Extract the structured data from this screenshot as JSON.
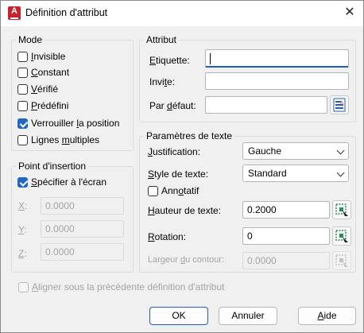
{
  "window": {
    "title": "Définition d'attribut",
    "close_glyph": "✕",
    "app_icon_letter": "A"
  },
  "mode": {
    "title": "Mode",
    "items": [
      {
        "pre": "",
        "ul": "I",
        "post": "nvisible",
        "checked": false
      },
      {
        "pre": "",
        "ul": "C",
        "post": "onstant",
        "checked": false
      },
      {
        "pre": "",
        "ul": "V",
        "post": "érifié",
        "checked": false
      },
      {
        "pre": "",
        "ul": "P",
        "post": "rédéfini",
        "checked": false
      },
      {
        "pre": "Verrouiller ",
        "ul": "l",
        "post": "a position",
        "checked": true
      },
      {
        "pre": "Lignes ",
        "ul": "m",
        "post": "ultiples",
        "checked": false
      }
    ]
  },
  "insertion": {
    "title": "Point d'insertion",
    "specify": {
      "pre": "",
      "ul": "S",
      "post": "pécifier à l'écran",
      "checked": true
    },
    "x": {
      "label_ul": "X",
      "label_post": ":",
      "value": "0.0000"
    },
    "y": {
      "label_ul": "Y",
      "label_post": ":",
      "value": "0.0000"
    },
    "z": {
      "label_ul": "Z",
      "label_post": ":",
      "value": "0.0000"
    }
  },
  "attribute": {
    "title": "Attribut",
    "tag": {
      "pre": "",
      "ul": "E",
      "post": "tiquette:",
      "value": ""
    },
    "prompt": {
      "pre": "Invi",
      "ul": "t",
      "post": "e:",
      "value": ""
    },
    "default": {
      "pre": "Par ",
      "ul": "d",
      "post": "éfaut:",
      "value": ""
    }
  },
  "text": {
    "title": "Paramètres de texte",
    "justification": {
      "pre": "",
      "ul": "J",
      "post": "ustification:",
      "value": "Gauche"
    },
    "style": {
      "pre": "",
      "ul": "S",
      "post": "tyle de texte:",
      "value": "Standard"
    },
    "annotative": {
      "pre": "Ann",
      "ul": "o",
      "post": "tatif",
      "checked": false
    },
    "height": {
      "pre": "",
      "ul": "H",
      "post": "auteur de texte:",
      "value": "0.2000"
    },
    "rotation": {
      "pre": "",
      "ul": "R",
      "post": "otation:",
      "value": "0"
    },
    "width": {
      "pre": "Largeur ",
      "ul": "d",
      "post": "u contour:",
      "value": "0.0000"
    }
  },
  "align": {
    "pre": "",
    "ul": "A",
    "post": "ligner sous la précédente définition d'attribut",
    "checked": false
  },
  "buttons": {
    "ok": "OK",
    "cancel": "Annuler",
    "help_ul": "A",
    "help_post": "ide"
  },
  "colors": {
    "accent": "#1f66c6",
    "brand": "#c8232c"
  }
}
